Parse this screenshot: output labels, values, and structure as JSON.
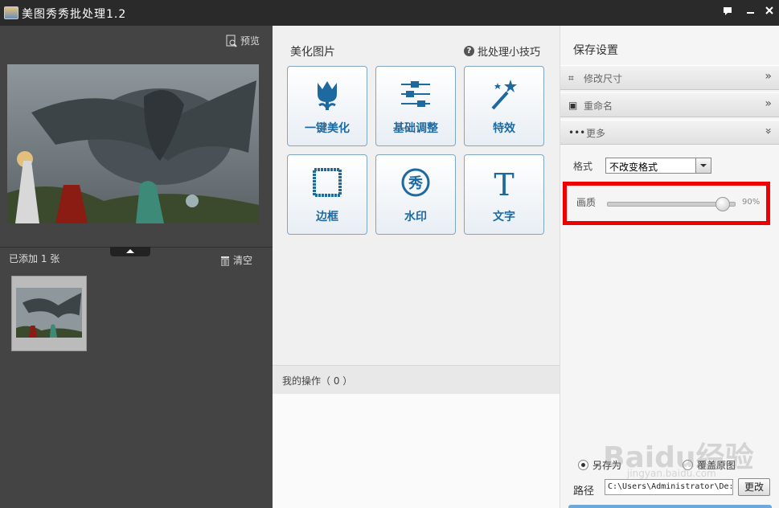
{
  "window": {
    "title": "美图秀秀批处理1.2",
    "controls": [
      "feedback-icon",
      "minimize-icon",
      "close-icon"
    ]
  },
  "left": {
    "preview_label": "预览",
    "added_count": "已添加 1 张",
    "clear_label": "清空"
  },
  "middle": {
    "section_title": "美化图片",
    "tips_label": "批处理小技巧",
    "tools": [
      {
        "label": "一键美化",
        "icon": "tulip-icon"
      },
      {
        "label": "基础调整",
        "icon": "sliders-icon"
      },
      {
        "label": "特效",
        "icon": "magic-wand-icon"
      },
      {
        "label": "边框",
        "icon": "frame-icon"
      },
      {
        "label": "水印",
        "icon": "watermark-icon"
      },
      {
        "label": "文字",
        "icon": "text-icon"
      }
    ],
    "my_operations": "我的操作（ 0 ）"
  },
  "right": {
    "title": "保存设置",
    "accordion": [
      {
        "label": "修改尺寸",
        "icon": "crop-icon"
      },
      {
        "label": "重命名",
        "icon": "rename-icon"
      },
      {
        "label": "更多",
        "icon": "more-icon"
      }
    ],
    "format_label": "格式",
    "format_value": "不改变格式",
    "quality_label": "画质",
    "quality_value": "90%",
    "quality_level": 90,
    "save_options": [
      "另存为",
      "覆盖原图"
    ],
    "selected_option": "另存为",
    "path_label": "路径",
    "path_value": "C:\\Users\\Administrator\\De:",
    "change_label": "更改"
  },
  "watermark": {
    "brand": "Baidu经验",
    "url": "jingyan.baidu.com"
  },
  "colors": {
    "highlight": "#e00000",
    "accent": "#1e6aa0",
    "titlebar": "#2a2a2a"
  }
}
